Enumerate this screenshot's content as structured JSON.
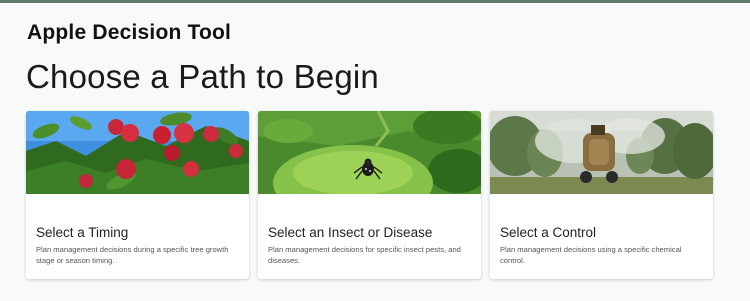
{
  "app": {
    "title": "Apple Decision Tool"
  },
  "page": {
    "heading": "Choose a Path to Begin"
  },
  "cards": [
    {
      "title": "Select a Timing",
      "description": "Plan management decisions during a specific tree growth stage or season timing.",
      "image": "apples-on-branch-photo"
    },
    {
      "title": "Select an Insect or Disease",
      "description": "Plan management decisions for specific insect pests, and diseases.",
      "image": "insect-on-green-apple-photo"
    },
    {
      "title": "Select a Control",
      "description": "Plan management decisions using a specific chemical control.",
      "image": "orchard-sprayer-photo"
    }
  ],
  "colors": {
    "accent_bar": "#5d7a6a",
    "page_bg": "#f8f9f9"
  }
}
